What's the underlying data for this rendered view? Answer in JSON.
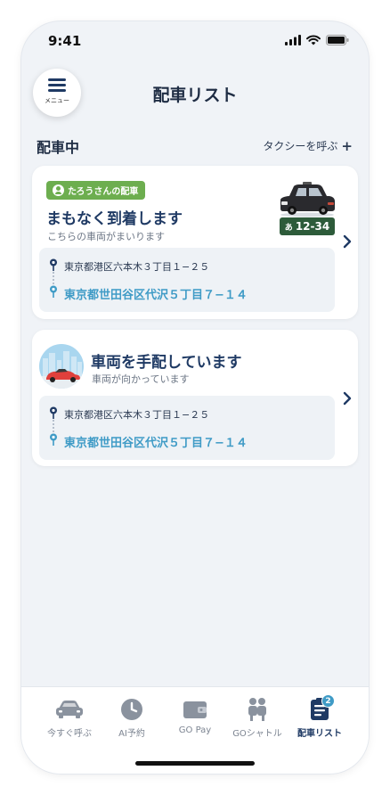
{
  "status_bar": {
    "time": "9:41"
  },
  "header": {
    "menu_label": "メニュー",
    "title": "配車リスト"
  },
  "section": {
    "title": "配車中",
    "call_taxi_label": "タクシーを呼ぶ",
    "call_taxi_icon": "+"
  },
  "cards": [
    {
      "badge": "たろうさんの配車",
      "headline": "まもなく到着します",
      "subtext": "こちらの車両がまいります",
      "plate_kana": "あ",
      "plate_number": "12-34",
      "from": "東京都港区六本木３丁目１−２５",
      "to": "東京都世田谷区代沢５丁目７−１４"
    },
    {
      "headline": "車両を手配しています",
      "subtext": "車両が向かっています",
      "from": "東京都港区六本木３丁目１−２５",
      "to": "東京都世田谷区代沢５丁目７−１４"
    }
  ],
  "tabbar": {
    "items": [
      {
        "label": "今すぐ呼ぶ",
        "icon": "car-icon"
      },
      {
        "label": "AI予約",
        "icon": "clock-icon"
      },
      {
        "label": "GO Pay",
        "icon": "wallet-icon"
      },
      {
        "label": "GOシャトル",
        "icon": "people-icon"
      },
      {
        "label": "配車リスト",
        "icon": "list-icon",
        "badge": "2",
        "active": true
      }
    ]
  },
  "colors": {
    "accent": "#1f3a64",
    "link": "#3f9bc6",
    "badge_green": "#6dae4f",
    "plate_green": "#2d5b3a"
  }
}
